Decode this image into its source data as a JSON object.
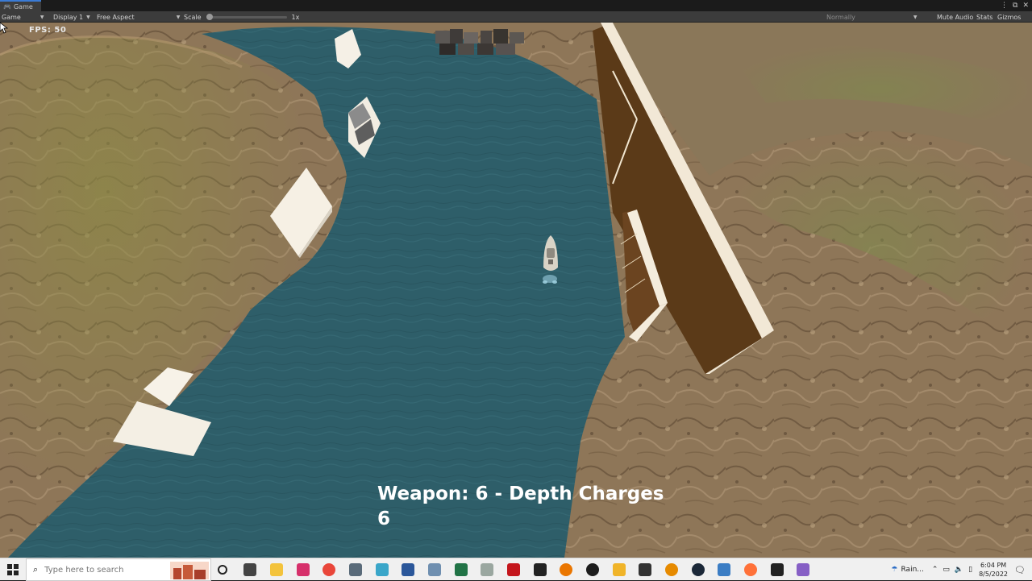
{
  "editor": {
    "tab_label": "Game",
    "view_mode": "Game",
    "display": "Display 1",
    "aspect": "Free Aspect",
    "scale_label": "Scale",
    "scale_value": "1x",
    "play_focus": "Normally",
    "mute_audio": "Mute Audio",
    "stats": "Stats",
    "gizmos": "Gizmos"
  },
  "hud": {
    "fps_label": "FPS",
    "fps_value": "50",
    "weapon_line": "Weapon: 6 - Depth Charges",
    "ammo": "6"
  },
  "taskbar": {
    "search_placeholder": "Type here to search",
    "weather": "Rain...",
    "time": "6:04 PM",
    "date": "8/5/2022",
    "apps": [
      "task-view",
      "file-explorer",
      "instagram",
      "chrome",
      "calculator",
      "paint",
      "word",
      "notepad",
      "excel",
      "feather",
      "acrobat",
      "unity-hub",
      "blender",
      "unity",
      "document",
      "headphones",
      "steam",
      "remote-desktop",
      "firefox",
      "unity-editor",
      "visual-studio"
    ]
  },
  "colors": {
    "water": "#2d5d68",
    "cliff": "#8c7456",
    "wall_dark": "#5a3a17",
    "wall_light": "#f4ecdc",
    "hud_text": "#ffffff",
    "taskbar_bg": "#f0f0f0"
  }
}
